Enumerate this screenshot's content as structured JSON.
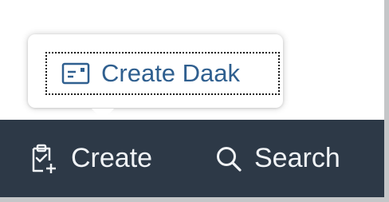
{
  "popup": {
    "items": [
      {
        "label": "Create Daak",
        "icon": "card-icon"
      }
    ]
  },
  "nav": {
    "items": [
      {
        "label": "Create",
        "icon": "clipboard-add-icon"
      },
      {
        "label": "Search",
        "icon": "search-icon"
      }
    ]
  },
  "colors": {
    "navbar_bg": "#2d3947",
    "nav_text": "#f1f4f7",
    "link_text": "#2f5f8f"
  }
}
